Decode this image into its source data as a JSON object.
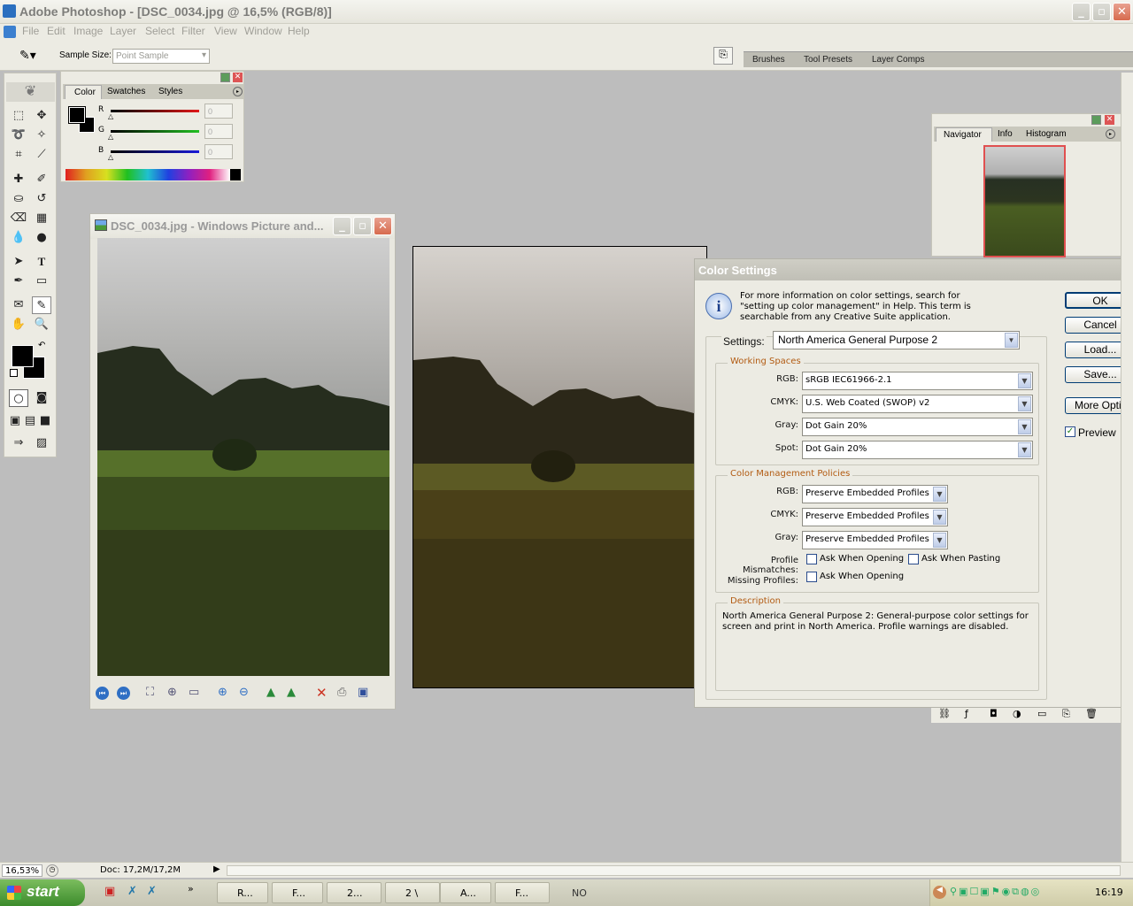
{
  "app": {
    "title": "Adobe Photoshop - [DSC_0034.jpg @ 16,5% (RGB/8)]",
    "menu": [
      "File",
      "Edit",
      "Image",
      "Layer",
      "Select",
      "Filter",
      "View",
      "Window",
      "Help"
    ]
  },
  "options": {
    "sample_size_label": "Sample Size:",
    "sample_size_value": "Point Sample",
    "well_tabs": [
      "Brushes",
      "Tool Presets",
      "Layer Comps"
    ]
  },
  "color_palette": {
    "tabs": [
      "Color",
      "Swatches",
      "Styles"
    ],
    "channels": [
      {
        "label": "R",
        "value": "0",
        "color": "#d62020"
      },
      {
        "label": "G",
        "value": "0",
        "color": "#2aa82a"
      },
      {
        "label": "B",
        "value": "0",
        "color": "#1a1ad0"
      }
    ]
  },
  "viewer": {
    "title": "DSC_0034.jpg - Windows Picture and..."
  },
  "navigator": {
    "tabs": [
      "Navigator",
      "Info",
      "Histogram"
    ]
  },
  "dialog": {
    "title": "Color Settings",
    "info": "For more information on color settings, search for \"setting up color management\" in Help. This term is searchable from any Creative Suite application.",
    "settings_label": "Settings:",
    "settings_value": "North America General Purpose 2",
    "working_spaces": {
      "legend": "Working Spaces",
      "rows": [
        {
          "label": "RGB:",
          "value": "sRGB IEC61966-2.1"
        },
        {
          "label": "CMYK:",
          "value": "U.S. Web Coated (SWOP) v2"
        },
        {
          "label": "Gray:",
          "value": "Dot Gain 20%"
        },
        {
          "label": "Spot:",
          "value": "Dot Gain 20%"
        }
      ]
    },
    "policies": {
      "legend": "Color Management Policies",
      "rows": [
        {
          "label": "RGB:",
          "value": "Preserve Embedded Profiles"
        },
        {
          "label": "CMYK:",
          "value": "Preserve Embedded Profiles"
        },
        {
          "label": "Gray:",
          "value": "Preserve Embedded Profiles"
        }
      ],
      "mismatch_label": "Profile Mismatches:",
      "ask_opening": "Ask When Opening",
      "ask_pasting": "Ask When Pasting",
      "missing_label": "Missing Profiles:",
      "missing_opening": "Ask When Opening"
    },
    "description": {
      "legend": "Description",
      "text": "North America General Purpose 2:  General-purpose color settings for screen and print in North America. Profile warnings are disabled."
    },
    "buttons": {
      "ok": "OK",
      "cancel": "Cancel",
      "load": "Load...",
      "save": "Save...",
      "more": "More Options"
    },
    "preview_label": "Preview",
    "preview_checked": true
  },
  "status": {
    "zoom": "16,53%",
    "doc": "Doc: 17,2M/17,2M"
  },
  "taskbar": {
    "start": "start",
    "tasks": [
      "R...",
      "F...",
      "2...",
      "2 \\",
      "A...",
      "F..."
    ],
    "lang": "NO",
    "clock": "16:19"
  }
}
